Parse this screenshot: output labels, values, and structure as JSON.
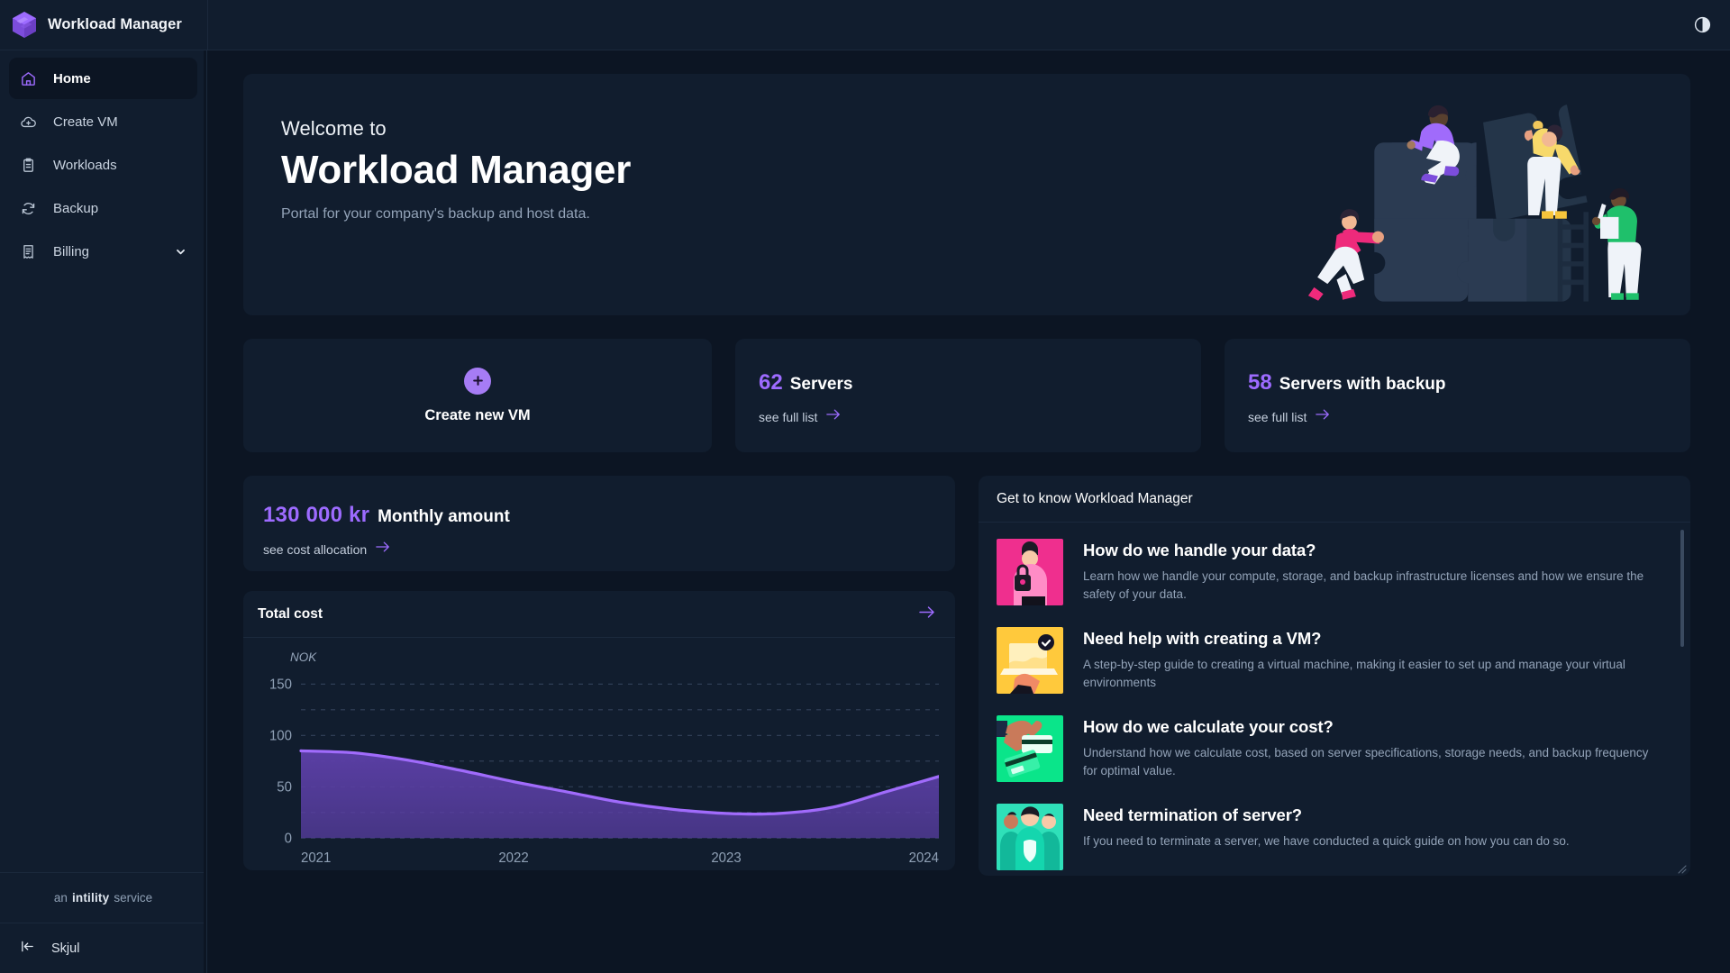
{
  "app": {
    "title": "Workload Manager",
    "logo_icon": "cube-logo-icon",
    "accent": "#9d6bff",
    "surface": "#111d2e",
    "background": "#0c1523"
  },
  "topbar": {
    "theme_toggle_icon": "contrast-half-circle-icon"
  },
  "sidebar": {
    "items": [
      {
        "label": "Home",
        "icon": "home-icon",
        "active": true,
        "expandable": false
      },
      {
        "label": "Create VM",
        "icon": "cloud-plus-icon",
        "active": false,
        "expandable": false
      },
      {
        "label": "Workloads",
        "icon": "clipboard-icon",
        "active": false,
        "expandable": false
      },
      {
        "label": "Backup",
        "icon": "refresh-icon",
        "active": false,
        "expandable": false
      },
      {
        "label": "Billing",
        "icon": "receipt-icon",
        "active": false,
        "expandable": true
      }
    ],
    "footer": {
      "prefix": "an",
      "brand": "intility",
      "suffix": "service"
    },
    "collapse": {
      "label": "Skjul",
      "icon": "collapse-left-icon"
    }
  },
  "hero": {
    "welcome": "Welcome to",
    "title": "Workload Manager",
    "subtitle": "Portal for your company's backup and host data.",
    "illustration": "puzzle-teamwork-illustration"
  },
  "cards": {
    "create_vm": {
      "label": "Create new VM",
      "icon": "plus-circle-icon"
    },
    "servers": {
      "count": "62",
      "label": "Servers",
      "link": "see full list",
      "link_icon": "arrow-right-icon"
    },
    "servers_backup": {
      "count": "58",
      "label": "Servers with backup",
      "link": "see full list",
      "link_icon": "arrow-right-icon"
    }
  },
  "monthly": {
    "amount": "130 000 kr",
    "label": "Monthly amount",
    "link": "see cost allocation",
    "link_icon": "arrow-right-icon"
  },
  "chart_card": {
    "title": "Total cost",
    "arrow_icon": "arrow-right-icon"
  },
  "chart_data": {
    "type": "area",
    "title": "Total cost",
    "xlabel": "",
    "ylabel": "NOK",
    "ylim": [
      0,
      165
    ],
    "yticks": [
      0,
      50,
      100,
      150
    ],
    "ytick_labels": [
      "0",
      "50",
      "100",
      "150"
    ],
    "grid": true,
    "grid_style": "dashed-horizontal",
    "legend": "none",
    "categories": [
      "2021",
      "2022",
      "2023",
      "2024"
    ],
    "xtick_labels": [
      "2021",
      "2022",
      "2023",
      "2024"
    ],
    "series": [
      {
        "name": "Total cost",
        "line_color": "#a06bfb",
        "fill_color": "#5b3fa6",
        "x": [
          2021.0,
          2021.25,
          2021.5,
          2021.75,
          2022.0,
          2022.25,
          2022.5,
          2022.75,
          2023.0,
          2023.25,
          2023.5,
          2023.75,
          2024.0
        ],
        "values": [
          85,
          83,
          76,
          66,
          55,
          45,
          35,
          28,
          24,
          24,
          30,
          45,
          60
        ]
      }
    ]
  },
  "get_to_know": {
    "title": "Get to know Workload Manager",
    "items": [
      {
        "heading": "How do we handle your data?",
        "body": "Learn how we handle your compute, storage, and backup infrastructure licenses and how we ensure the safety of your data.",
        "thumb": "person-with-lock-illustration",
        "thumb_color": "#ef2f8e"
      },
      {
        "heading": "Need help with creating a VM?",
        "body": "A step-by-step guide to creating a virtual machine, making it easier to set up and manage your virtual environments",
        "thumb": "laptop-checkmark-illustration",
        "thumb_color": "#ffc93c"
      },
      {
        "heading": "How do we calculate your cost?",
        "body": "Understand how we calculate cost, based on server specifications, storage needs, and backup frequency for optimal value.",
        "thumb": "hand-credit-card-illustration",
        "thumb_color": "#0ae58a"
      },
      {
        "heading": "Need termination of server?",
        "body": "If you need to terminate a server, we have conducted a quick guide on how you can do so.",
        "thumb": "team-shield-illustration",
        "thumb_color": "#2fe0b9"
      }
    ]
  }
}
